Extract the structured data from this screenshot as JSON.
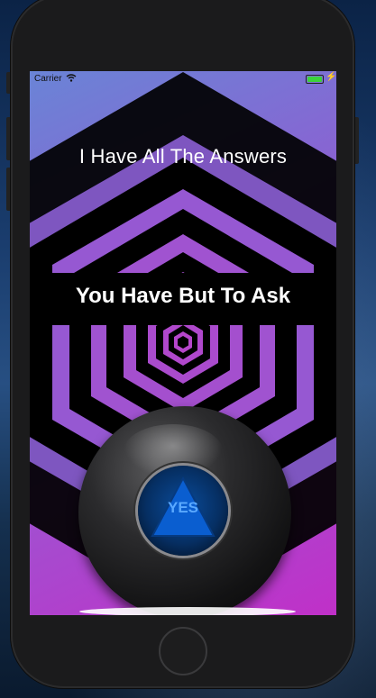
{
  "status_bar": {
    "carrier": "Carrier",
    "time": ""
  },
  "screen": {
    "title": "I Have All The Answers",
    "subtitle": "You Have But To Ask"
  },
  "ball": {
    "answer": "YES"
  },
  "colors": {
    "gradient_start": "#6a84d6",
    "gradient_end": "#c030c8",
    "answer_text": "#5aa9ff",
    "battery": "#3bd33b"
  }
}
